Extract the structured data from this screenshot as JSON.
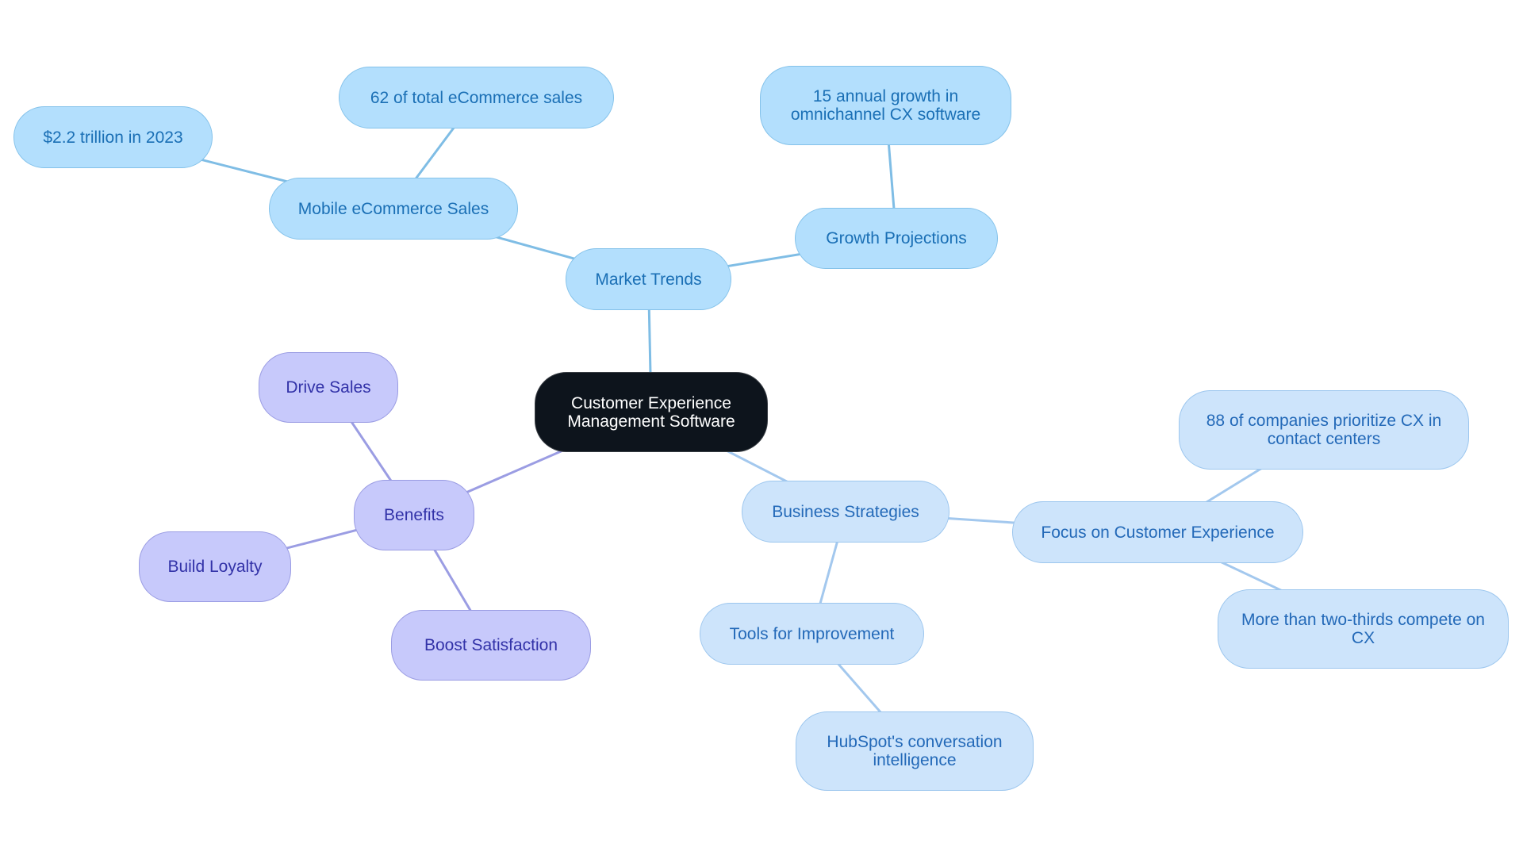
{
  "title": "Customer Experience Management Software",
  "colors": {
    "root_fill": "#0d141c",
    "market_fill": "#b3dffd",
    "market_edge": "#7fbde5",
    "business_fill": "#cde4fb",
    "business_edge": "#a3c8ee",
    "benefits_fill": "#c7c9fb",
    "benefits_edge": "#9b9de3"
  },
  "nodes": {
    "root": "Customer Experience Management Software",
    "market_trends": "Market Trends",
    "mobile_ecommerce": "Mobile eCommerce Sales",
    "trillion_2023": "$2.2 trillion in 2023",
    "total_ecommerce": "62 of total eCommerce sales",
    "growth_projections": "Growth Projections",
    "annual_growth": "15 annual growth in omnichannel CX software",
    "benefits": "Benefits",
    "drive_sales": "Drive Sales",
    "build_loyalty": "Build Loyalty",
    "boost_satisfaction": "Boost Satisfaction",
    "business_strategies": "Business Strategies",
    "focus_cx": "Focus on Customer Experience",
    "prioritize_cx": "88 of companies prioritize CX in contact centers",
    "compete_cx": "More than two-thirds compete on CX",
    "tools_improvement": "Tools for Improvement",
    "hubspot": "HubSpot's conversation intelligence"
  },
  "edges": [
    {
      "from": "root",
      "to": "market_trends",
      "group": "market"
    },
    {
      "from": "market_trends",
      "to": "mobile_ecommerce",
      "group": "market"
    },
    {
      "from": "mobile_ecommerce",
      "to": "trillion_2023",
      "group": "market"
    },
    {
      "from": "mobile_ecommerce",
      "to": "total_ecommerce",
      "group": "market"
    },
    {
      "from": "market_trends",
      "to": "growth_projections",
      "group": "market"
    },
    {
      "from": "growth_projections",
      "to": "annual_growth",
      "group": "market"
    },
    {
      "from": "root",
      "to": "benefits",
      "group": "benefits"
    },
    {
      "from": "benefits",
      "to": "drive_sales",
      "group": "benefits"
    },
    {
      "from": "benefits",
      "to": "build_loyalty",
      "group": "benefits"
    },
    {
      "from": "benefits",
      "to": "boost_satisfaction",
      "group": "benefits"
    },
    {
      "from": "root",
      "to": "business_strategies",
      "group": "business"
    },
    {
      "from": "business_strategies",
      "to": "focus_cx",
      "group": "business"
    },
    {
      "from": "focus_cx",
      "to": "prioritize_cx",
      "group": "business"
    },
    {
      "from": "focus_cx",
      "to": "compete_cx",
      "group": "business"
    },
    {
      "from": "business_strategies",
      "to": "tools_improvement",
      "group": "business"
    },
    {
      "from": "tools_improvement",
      "to": "hubspot",
      "group": "business"
    }
  ]
}
